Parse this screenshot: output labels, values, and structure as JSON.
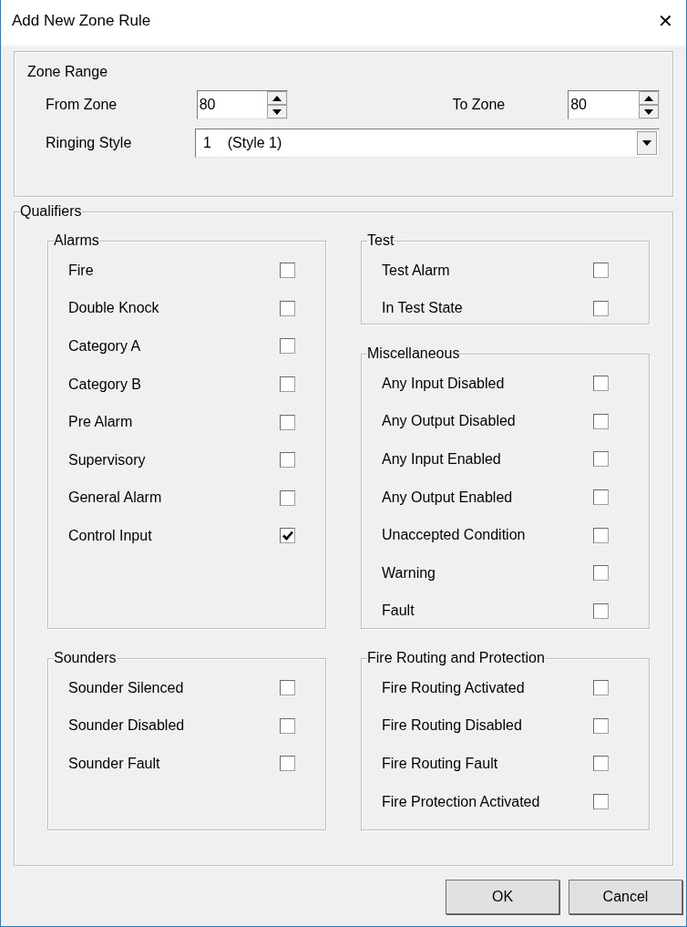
{
  "window": {
    "title": "Add New Zone Rule",
    "close": "✕"
  },
  "zone_range": {
    "title": "Zone Range",
    "from_zone": {
      "label": "From Zone",
      "value": "80"
    },
    "to_zone": {
      "label": "To Zone",
      "value": "80"
    },
    "ringing_style": {
      "label": "Ringing Style",
      "value": "1    (Style 1)"
    }
  },
  "qualifiers": {
    "title": "Qualifiers",
    "groups": [
      {
        "title": "Alarms",
        "items": [
          {
            "label": "Fire",
            "checked": false
          },
          {
            "label": "Double Knock",
            "checked": false
          },
          {
            "label": "Category A",
            "checked": false
          },
          {
            "label": "Category B",
            "checked": false
          },
          {
            "label": "Pre Alarm",
            "checked": false
          },
          {
            "label": "Supervisory",
            "checked": false
          },
          {
            "label": "General Alarm",
            "checked": false
          },
          {
            "label": "Control Input",
            "checked": true
          }
        ]
      },
      {
        "title": "Test",
        "items": [
          {
            "label": "Test Alarm",
            "checked": false
          },
          {
            "label": "In Test State",
            "checked": false
          }
        ]
      },
      {
        "title": "Miscellaneous",
        "items": [
          {
            "label": "Any Input Disabled",
            "checked": false
          },
          {
            "label": "Any Output Disabled",
            "checked": false
          },
          {
            "label": "Any Input Enabled",
            "checked": false
          },
          {
            "label": "Any Output Enabled",
            "checked": false
          },
          {
            "label": "Unaccepted Condition",
            "checked": false
          },
          {
            "label": "Warning",
            "checked": false
          },
          {
            "label": "Fault",
            "checked": false
          }
        ]
      },
      {
        "title": "Sounders",
        "items": [
          {
            "label": "Sounder Silenced",
            "checked": false
          },
          {
            "label": "Sounder Disabled",
            "checked": false
          },
          {
            "label": "Sounder Fault",
            "checked": false
          }
        ]
      },
      {
        "title": "Fire Routing and Protection",
        "items": [
          {
            "label": "Fire Routing Activated",
            "checked": false
          },
          {
            "label": "Fire Routing Disabled",
            "checked": false
          },
          {
            "label": "Fire Routing Fault",
            "checked": false
          },
          {
            "label": "Fire Protection Activated",
            "checked": false
          }
        ]
      }
    ]
  },
  "buttons": [
    {
      "label": "OK"
    },
    {
      "label": "Cancel"
    }
  ]
}
